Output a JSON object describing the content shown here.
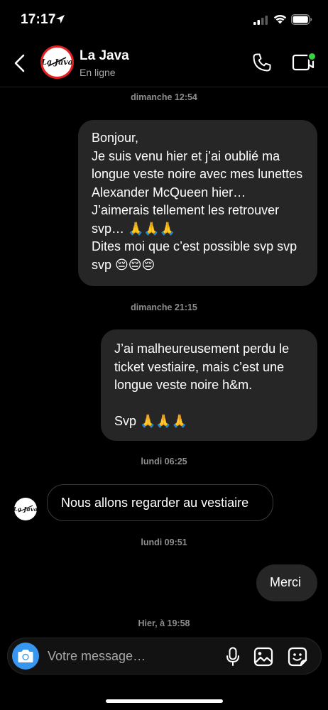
{
  "status_bar": {
    "time": "17:17"
  },
  "header": {
    "contact_name": "La Java",
    "contact_status": "En ligne",
    "avatar_text": "La Java"
  },
  "messages": [
    {
      "type": "timestamp",
      "text": "dimanche 12:54"
    },
    {
      "type": "sent",
      "text": "Bonjour,\nJe suis venu hier et j’ai oublié ma longue veste noire avec mes lunettes Alexander McQueen hier…\nJ’aimerais tellement les retrouver svp… 🙏🙏🙏\nDites moi que c’est possible svp svp svp 😔😔😔"
    },
    {
      "type": "timestamp",
      "text": "dimanche 21:15"
    },
    {
      "type": "sent",
      "text": "J’ai malheureusement perdu le ticket vestiaire, mais c’est une longue veste noire h&m.\n\nSvp 🙏🙏🙏"
    },
    {
      "type": "timestamp",
      "text": "lundi 06:25"
    },
    {
      "type": "received",
      "text": "Nous allons regarder au vestiaire"
    },
    {
      "type": "timestamp",
      "text": "lundi 09:51"
    },
    {
      "type": "sent",
      "text": "Merci"
    },
    {
      "type": "timestamp",
      "text": "Hier, à 19:58"
    }
  ],
  "composer": {
    "placeholder": "Votre message…"
  },
  "colors": {
    "background": "#000000",
    "bubble_sent": "#262626",
    "accent_blue": "#3797f0",
    "online_green": "#3ad045",
    "avatar_ring": "#e51f1f"
  }
}
